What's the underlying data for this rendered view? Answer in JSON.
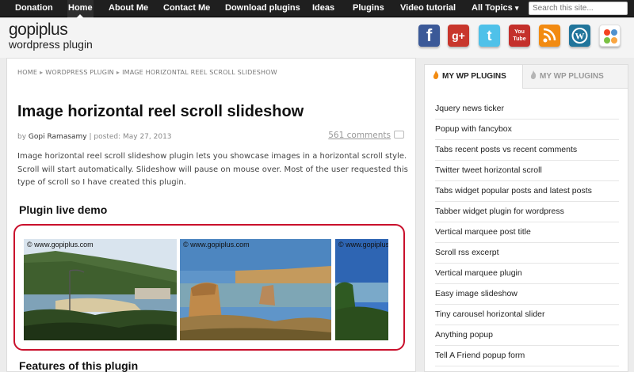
{
  "nav": {
    "items": [
      "Donation",
      "Home",
      "About Me",
      "Contact Me",
      "Download plugins",
      "Ideas",
      "Plugins",
      "Video tutorial",
      "All Topics"
    ],
    "active": "Home",
    "search_placeholder": "Search this site..."
  },
  "logo": {
    "line1": "gopiplus",
    "line2": "wordpress plugin"
  },
  "social": [
    {
      "name": "facebook-icon",
      "color": "#3b5998",
      "glyph": "f"
    },
    {
      "name": "google-plus-icon",
      "color": "#c8362c",
      "glyph": "g+"
    },
    {
      "name": "twitter-icon",
      "color": "#4fc1e9",
      "glyph": "t"
    },
    {
      "name": "youtube-icon",
      "color": "#c4302b",
      "glyph": "You Tube"
    },
    {
      "name": "rss-icon",
      "color": "#f28b12",
      "glyph": "rss"
    },
    {
      "name": "wordpress-icon",
      "color": "#21759b",
      "glyph": "W"
    },
    {
      "name": "joomla-icon",
      "color": "#ffffff",
      "glyph": "joomla"
    }
  ],
  "breadcrumb": [
    "Home",
    "Wordpress plugin",
    "Image horizontal reel scroll slideshow"
  ],
  "post": {
    "title": "Image horizontal reel scroll slideshow",
    "meta_by": "by",
    "author": "Gopi Ramasamy",
    "meta_posted": "| posted: May 27, 2013",
    "comments": "561 comments",
    "intro": "Image horizontal reel scroll slideshow plugin lets you showcase images in a horizontal scroll style. Scroll will start automatically. Slideshow will pause on mouse over. Most of the user requested this type of scroll so I have created this plugin.",
    "demo_heading": "Plugin live demo",
    "watermark": "© www.gopiplus.com",
    "features_heading": "Features of this plugin"
  },
  "sidebar": {
    "tabs": [
      "MY WP PLUGINS",
      "MY WP PLUGINS"
    ],
    "items": [
      "Jquery news ticker",
      "Popup with fancybox",
      "Tabs recent posts vs recent comments",
      "Twitter tweet horizontal scroll",
      "Tabs widget popular posts and latest posts",
      "Tabber widget plugin for wordpress",
      "Vertical marquee post title",
      "Scroll rss excerpt",
      "Vertical marquee plugin",
      "Easy image slideshow",
      "Tiny carousel horizontal slider",
      "Anything popup",
      "Tell A Friend popup form"
    ]
  },
  "colors": {
    "accent_red": "#c9102c",
    "nav_bg": "#1f1f1f"
  }
}
